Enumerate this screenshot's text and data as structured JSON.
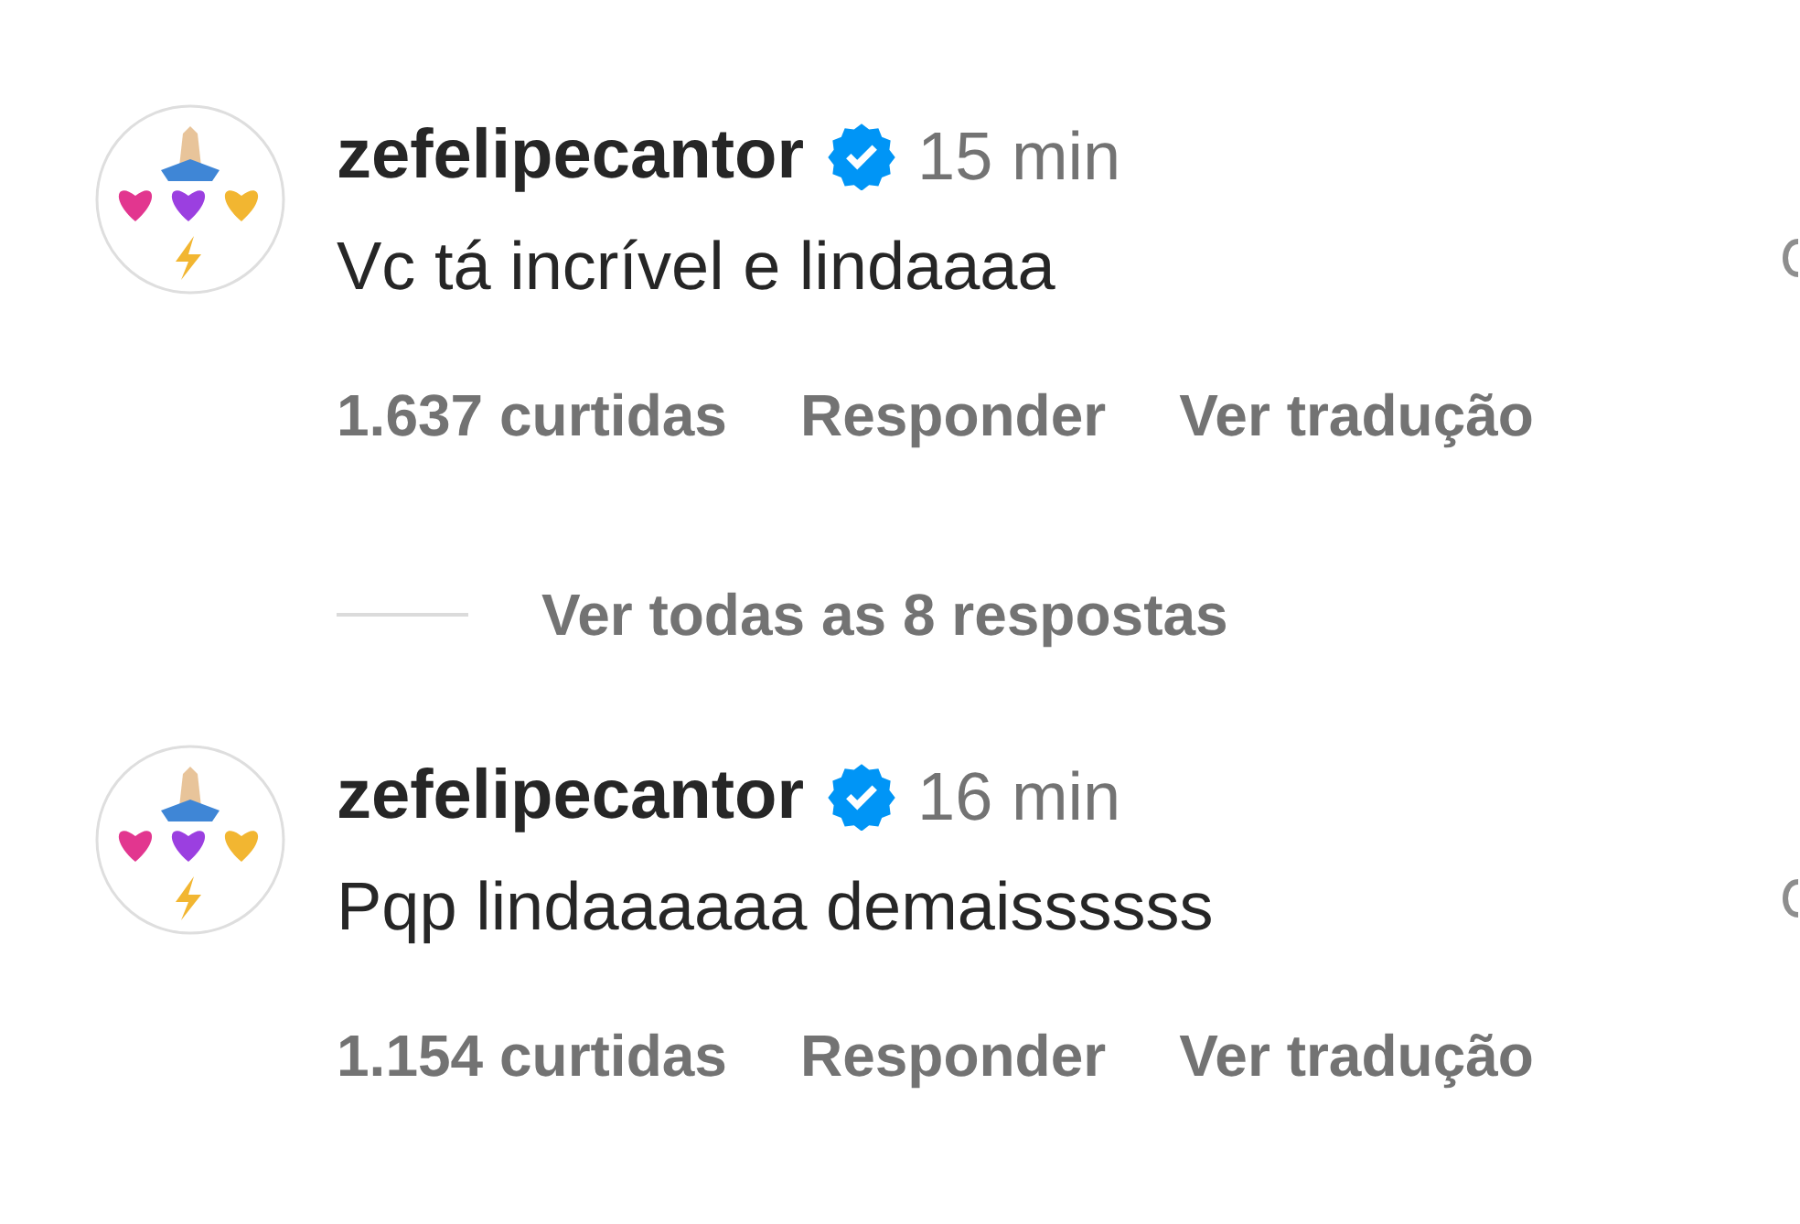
{
  "comments": [
    {
      "username": "zefelipecantor",
      "verified": true,
      "time": "15 min",
      "text": "Vc tá incrível e lindaaaa",
      "likes": "1.637 curtidas",
      "reply": "Responder",
      "translate": "Ver tradução",
      "replies_link": "Ver todas as 8 respostas"
    },
    {
      "username": "zefelipecantor",
      "verified": true,
      "time": "16 min",
      "text": "Pqp lindaaaaaa demaissssss",
      "likes": "1.154 curtidas",
      "reply": "Responder",
      "translate": "Ver tradução"
    }
  ]
}
